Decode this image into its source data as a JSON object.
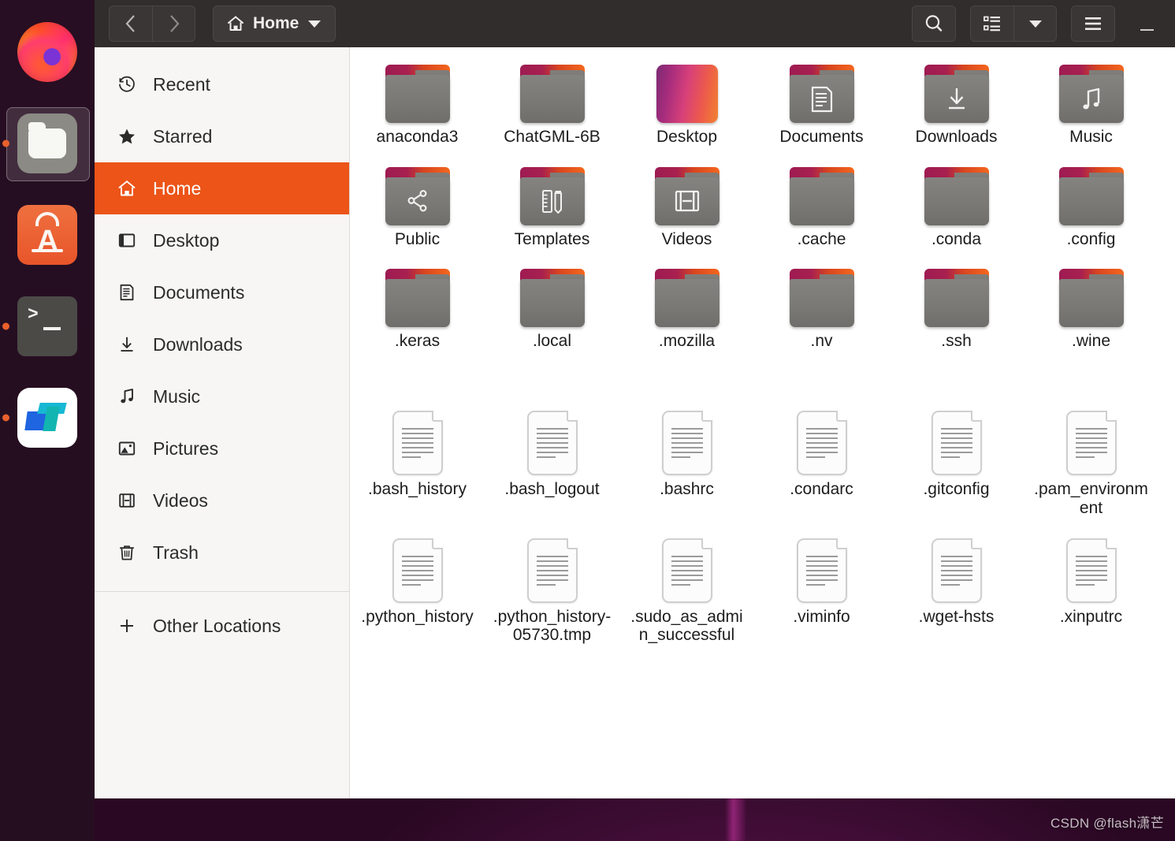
{
  "desktop": {
    "watermark": "CSDN @flash潇芒"
  },
  "dock": {
    "items": [
      {
        "name": "firefox",
        "label": "Firefox",
        "running": false,
        "active": false
      },
      {
        "name": "files",
        "label": "Files",
        "running": true,
        "active": true
      },
      {
        "name": "ubuntu-software",
        "label": "Ubuntu Software",
        "letter": "A",
        "running": false,
        "active": false
      },
      {
        "name": "terminal",
        "label": "Terminal",
        "prompt": ">",
        "running": true,
        "active": false
      },
      {
        "name": "blue-app",
        "label": "Application",
        "running": true,
        "active": false
      }
    ]
  },
  "window": {
    "header": {
      "back_label": "Back",
      "forward_label": "Forward",
      "path_label": "Home",
      "path_icon": "home-icon",
      "dropdown_icon": "chevron-down-icon",
      "search_icon": "search-icon",
      "view_list_icon": "list-view-icon",
      "view_dropdown_icon": "chevron-down-icon",
      "menu_icon": "hamburger-menu-icon",
      "minimize_label": "Minimize"
    },
    "sidebar": {
      "items": [
        {
          "label": "Recent",
          "icon": "clock-icon",
          "selected": false
        },
        {
          "label": "Starred",
          "icon": "star-icon",
          "selected": false
        },
        {
          "label": "Home",
          "icon": "home-icon",
          "selected": true
        },
        {
          "label": "Desktop",
          "icon": "desktop-icon",
          "selected": false
        },
        {
          "label": "Documents",
          "icon": "documents-icon",
          "selected": false
        },
        {
          "label": "Downloads",
          "icon": "download-icon",
          "selected": false
        },
        {
          "label": "Music",
          "icon": "music-note-icon",
          "selected": false
        },
        {
          "label": "Pictures",
          "icon": "picture-icon",
          "selected": false
        },
        {
          "label": "Videos",
          "icon": "film-icon",
          "selected": false
        },
        {
          "label": "Trash",
          "icon": "trash-icon",
          "selected": false
        }
      ],
      "other_locations": {
        "label": "Other Locations",
        "icon": "plus-icon"
      }
    },
    "content": {
      "rows": [
        [
          {
            "label": "anaconda3",
            "kind": "folder",
            "emblem": "none"
          },
          {
            "label": "ChatGML-6B",
            "kind": "folder",
            "emblem": "none"
          },
          {
            "label": "Desktop",
            "kind": "desktop-gradient",
            "emblem": "none"
          },
          {
            "label": "Documents",
            "kind": "folder",
            "emblem": "document"
          },
          {
            "label": "Downloads",
            "kind": "folder",
            "emblem": "download"
          },
          {
            "label": "Music",
            "kind": "folder",
            "emblem": "music"
          }
        ],
        [
          {
            "label": "Public",
            "kind": "folder",
            "emblem": "share"
          },
          {
            "label": "Templates",
            "kind": "folder",
            "emblem": "template"
          },
          {
            "label": "Videos",
            "kind": "folder",
            "emblem": "film"
          },
          {
            "label": ".cache",
            "kind": "folder",
            "emblem": "none"
          },
          {
            "label": ".conda",
            "kind": "folder",
            "emblem": "none"
          },
          {
            "label": ".config",
            "kind": "folder",
            "emblem": "none"
          }
        ],
        [
          {
            "label": ".keras",
            "kind": "folder",
            "emblem": "none"
          },
          {
            "label": ".local",
            "kind": "folder",
            "emblem": "none"
          },
          {
            "label": ".mozilla",
            "kind": "folder",
            "emblem": "none"
          },
          {
            "label": ".nv",
            "kind": "folder",
            "emblem": "none"
          },
          {
            "label": ".ssh",
            "kind": "folder",
            "emblem": "none"
          },
          {
            "label": ".wine",
            "kind": "folder",
            "emblem": "none"
          }
        ],
        [
          {
            "label": ".bash_history",
            "kind": "textfile",
            "emblem": "none"
          },
          {
            "label": ".bash_logout",
            "kind": "textfile",
            "emblem": "none"
          },
          {
            "label": ".bashrc",
            "kind": "textfile",
            "emblem": "none"
          },
          {
            "label": ".condarc",
            "kind": "textfile",
            "emblem": "none"
          },
          {
            "label": ".gitconfig",
            "kind": "textfile",
            "emblem": "none"
          },
          {
            "label": ".pam_environment",
            "kind": "textfile",
            "emblem": "none"
          }
        ],
        [
          {
            "label": ".python_history",
            "kind": "textfile",
            "emblem": "none"
          },
          {
            "label": ".python_history-05730.tmp",
            "kind": "textfile",
            "emblem": "none"
          },
          {
            "label": ".sudo_as_admin_successful",
            "kind": "textfile",
            "emblem": "none"
          },
          {
            "label": ".viminfo",
            "kind": "textfile",
            "emblem": "none"
          },
          {
            "label": ".wget-hsts",
            "kind": "textfile",
            "emblem": "none"
          },
          {
            "label": ".xinputrc",
            "kind": "textfile",
            "emblem": "none"
          }
        ]
      ]
    }
  },
  "colors": {
    "accent_orange": "#ec5418",
    "headerbar": "#312d2c",
    "sidebar_bg": "#f7f6f5",
    "folder_tab_left": "#9e1b52",
    "folder_tab_right": "#f4671e",
    "folder_body": "#7a7975",
    "wallpaper": "#2e0a27",
    "dock_bg": "#260f21"
  }
}
